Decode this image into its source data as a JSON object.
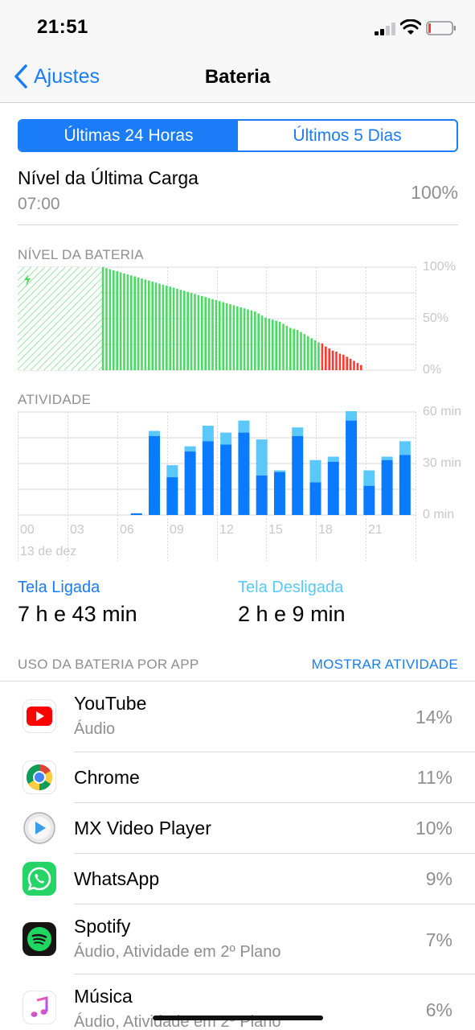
{
  "status": {
    "time": "21:51"
  },
  "nav": {
    "back_label": "Ajustes",
    "title": "Bateria"
  },
  "segment": {
    "options": [
      "Últimas 24 Horas",
      "Últimos 5 Dias"
    ],
    "selected": 0
  },
  "last_charge": {
    "title": "Nível da Última Carga",
    "time": "07:00",
    "percent": "100%"
  },
  "battery_chart": {
    "label": "NÍVEL DA BATERIA",
    "y_ticks": [
      "100%",
      "50%",
      "0%"
    ],
    "charging_until_index": 22,
    "low_from_index": 62,
    "levels": [
      100,
      99,
      98,
      97,
      96,
      95,
      94,
      93,
      92,
      91,
      90,
      89,
      88,
      87,
      86,
      85,
      84,
      83,
      82,
      81,
      80,
      79,
      78,
      77,
      76,
      75,
      74,
      73,
      72,
      71,
      70,
      69,
      68,
      67,
      66,
      65,
      64,
      63,
      62,
      61,
      60,
      59,
      58,
      57,
      55,
      53,
      51,
      50,
      49,
      48,
      47,
      45,
      43,
      41,
      40,
      39,
      37,
      35,
      33,
      31,
      29,
      27,
      26,
      23,
      21,
      19,
      18,
      16,
      15,
      13,
      11,
      9,
      7,
      5
    ]
  },
  "chart_data": {
    "type": "bar",
    "title": "ATIVIDADE",
    "x_ticks": [
      "00",
      "03",
      "06",
      "09",
      "12",
      "15",
      "18",
      "21"
    ],
    "date_label": "13 de dez",
    "y_ticks": [
      "60 min",
      "30 min",
      "0 min"
    ],
    "ylim": [
      0,
      60
    ],
    "categories": [
      "00",
      "01",
      "02",
      "03",
      "04",
      "05",
      "06",
      "07",
      "08",
      "09",
      "10",
      "11",
      "12",
      "13",
      "14",
      "15",
      "16",
      "17",
      "18",
      "19",
      "20",
      "21"
    ],
    "series": [
      {
        "name": "Tela Ligada",
        "values": [
          0,
          0,
          0,
          0,
          0,
          0,
          1,
          46,
          22,
          37,
          43,
          41,
          48,
          23,
          25,
          46,
          19,
          31,
          55,
          17,
          32,
          35
        ]
      },
      {
        "name": "Tela Desligada",
        "values": [
          0,
          0,
          0,
          0,
          0,
          0,
          0,
          3,
          7,
          3,
          9,
          7,
          7,
          21,
          1,
          5,
          13,
          3,
          6,
          9,
          2,
          8
        ]
      }
    ]
  },
  "screen": {
    "on_label": "Tela Ligada",
    "on_value": "7 h e 43 min",
    "off_label": "Tela Desligada",
    "off_value": "2 h e 9 min"
  },
  "apps": {
    "header": "USO DA BATERIA POR APP",
    "action": "MOSTRAR ATIVIDADE",
    "items": [
      {
        "name": "YouTube",
        "sub": "Áudio",
        "pct": "14%",
        "icon": "youtube-icon"
      },
      {
        "name": "Chrome",
        "sub": "",
        "pct": "11%",
        "icon": "chrome-icon"
      },
      {
        "name": "MX Video Player",
        "sub": "",
        "pct": "10%",
        "icon": "mx-player-icon"
      },
      {
        "name": "WhatsApp",
        "sub": "",
        "pct": "9%",
        "icon": "whatsapp-icon"
      },
      {
        "name": "Spotify",
        "sub": "Áudio, Atividade em 2º Plano",
        "pct": "7%",
        "icon": "spotify-icon"
      },
      {
        "name": "Música",
        "sub": "Áudio, Atividade em 2º Plano",
        "pct": "6%",
        "icon": "music-icon"
      }
    ]
  },
  "colors": {
    "accent": "#1a7cf6",
    "charging_green": "#4cd964",
    "low_red": "#ff3b30",
    "screen_on": "#0a7aff",
    "screen_off": "#5ac8fa"
  }
}
